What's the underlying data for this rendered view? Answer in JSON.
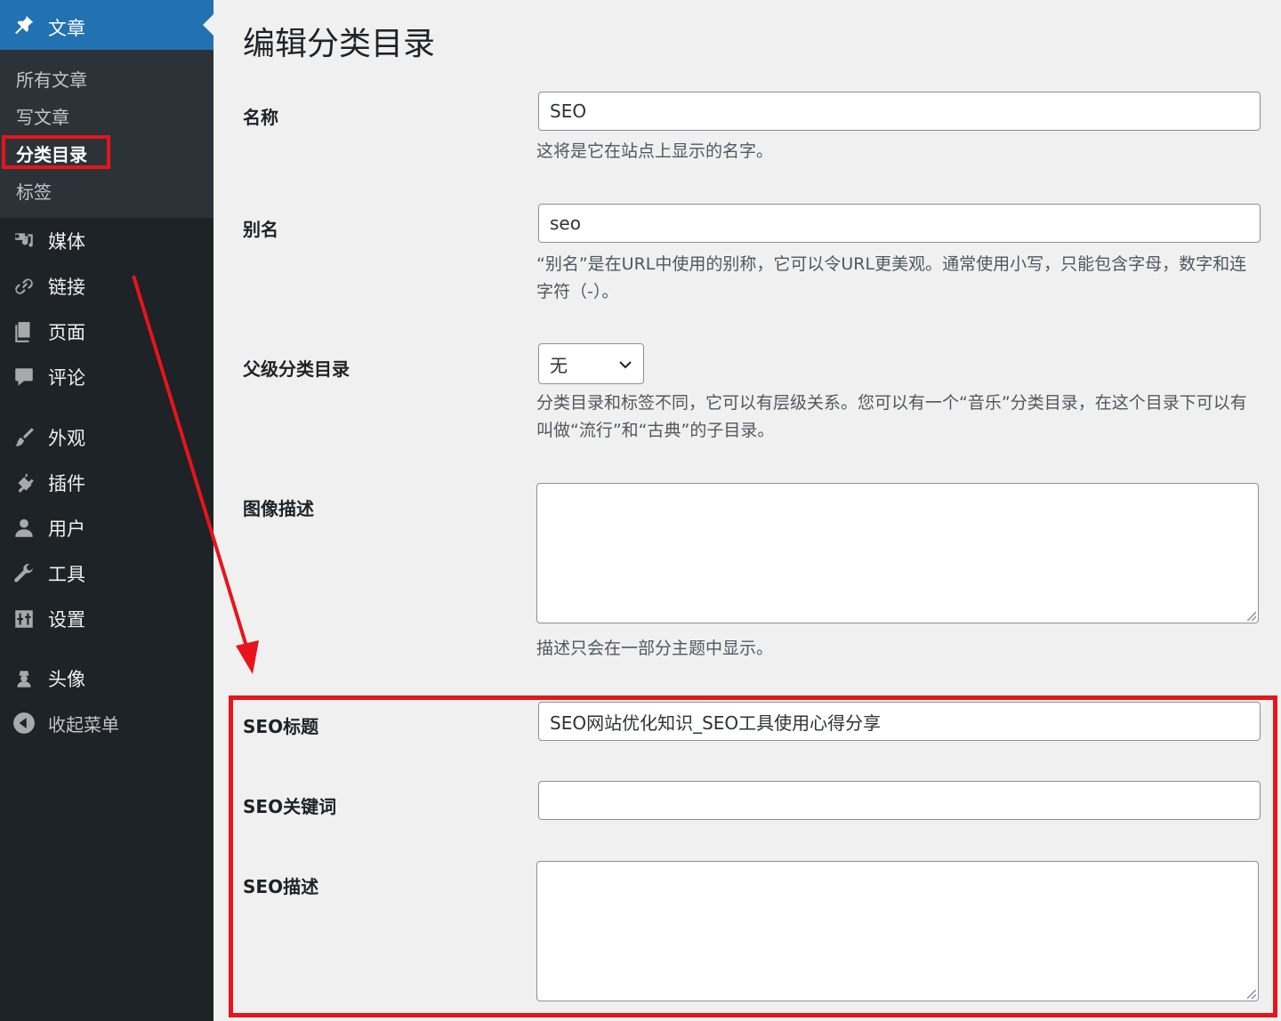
{
  "sidebar": {
    "current_menu": {
      "label": "文章",
      "icon": "pin-icon"
    },
    "submenu": [
      {
        "label": "所有文章"
      },
      {
        "label": "写文章"
      },
      {
        "label": "分类目录",
        "active": true
      },
      {
        "label": "标签"
      }
    ],
    "menu": [
      {
        "label": "媒体",
        "icon": "media-icon"
      },
      {
        "label": "链接",
        "icon": "link-icon"
      },
      {
        "label": "页面",
        "icon": "page-icon"
      },
      {
        "label": "评论",
        "icon": "comment-icon"
      },
      {
        "label": "外观",
        "icon": "appearance-icon"
      },
      {
        "label": "插件",
        "icon": "plugin-icon"
      },
      {
        "label": "用户",
        "icon": "user-icon"
      },
      {
        "label": "工具",
        "icon": "tools-icon"
      },
      {
        "label": "设置",
        "icon": "settings-icon"
      },
      {
        "label": "头像",
        "icon": "avatar-icon"
      },
      {
        "label": "收起菜单",
        "icon": "collapse-icon"
      }
    ]
  },
  "page": {
    "title": "编辑分类目录",
    "fields": {
      "name": {
        "label": "名称",
        "value": "SEO",
        "help": "这将是它在站点上显示的名字。"
      },
      "slug": {
        "label": "别名",
        "value": "seo",
        "help": "“别名”是在URL中使用的别称，它可以令URL更美观。通常使用小写，只能包含字母，数字和连字符（-）。"
      },
      "parent": {
        "label": "父级分类目录",
        "value": "无",
        "help": "分类目录和标签不同，它可以有层级关系。您可以有一个“音乐”分类目录，在这个目录下可以有叫做“流行”和“古典”的子目录。"
      },
      "description": {
        "label": "图像描述",
        "value": "",
        "help": "描述只会在一部分主题中显示。"
      },
      "seo_title": {
        "label": "SEO标题",
        "value": "SEO网站优化知识_SEO工具使用心得分享"
      },
      "seo_keywords": {
        "label": "SEO关键词",
        "value": ""
      },
      "seo_description": {
        "label": "SEO描述",
        "value": ""
      }
    }
  },
  "colors": {
    "sidebar_bg": "#1d2327",
    "submenu_bg": "#2c3338",
    "accent": "#2271b1",
    "annotation_red": "#e8141c",
    "page_bg": "#f0f0f1"
  }
}
